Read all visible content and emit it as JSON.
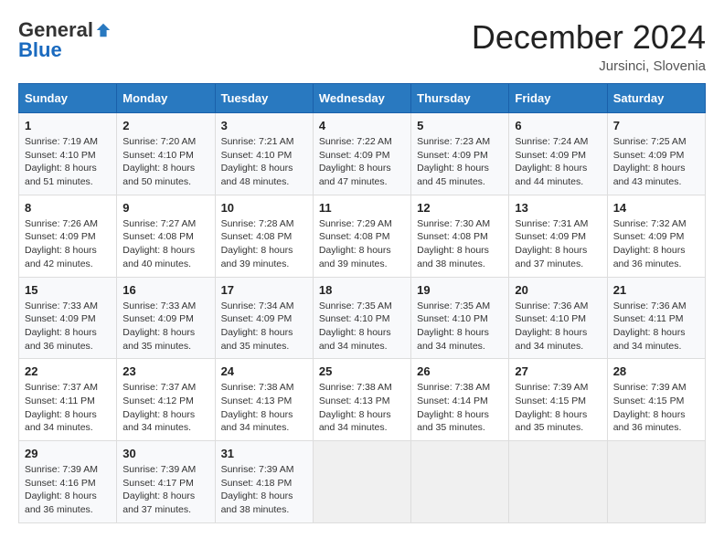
{
  "logo": {
    "general": "General",
    "blue": "Blue"
  },
  "header": {
    "month": "December 2024",
    "location": "Jursinci, Slovenia"
  },
  "weekdays": [
    "Sunday",
    "Monday",
    "Tuesday",
    "Wednesday",
    "Thursday",
    "Friday",
    "Saturday"
  ],
  "weeks": [
    [
      {
        "day": 1,
        "sunrise": "7:19 AM",
        "sunset": "4:10 PM",
        "daylight": "8 hours and 51 minutes."
      },
      {
        "day": 2,
        "sunrise": "7:20 AM",
        "sunset": "4:10 PM",
        "daylight": "8 hours and 50 minutes."
      },
      {
        "day": 3,
        "sunrise": "7:21 AM",
        "sunset": "4:10 PM",
        "daylight": "8 hours and 48 minutes."
      },
      {
        "day": 4,
        "sunrise": "7:22 AM",
        "sunset": "4:09 PM",
        "daylight": "8 hours and 47 minutes."
      },
      {
        "day": 5,
        "sunrise": "7:23 AM",
        "sunset": "4:09 PM",
        "daylight": "8 hours and 45 minutes."
      },
      {
        "day": 6,
        "sunrise": "7:24 AM",
        "sunset": "4:09 PM",
        "daylight": "8 hours and 44 minutes."
      },
      {
        "day": 7,
        "sunrise": "7:25 AM",
        "sunset": "4:09 PM",
        "daylight": "8 hours and 43 minutes."
      }
    ],
    [
      {
        "day": 8,
        "sunrise": "7:26 AM",
        "sunset": "4:09 PM",
        "daylight": "8 hours and 42 minutes."
      },
      {
        "day": 9,
        "sunrise": "7:27 AM",
        "sunset": "4:08 PM",
        "daylight": "8 hours and 40 minutes."
      },
      {
        "day": 10,
        "sunrise": "7:28 AM",
        "sunset": "4:08 PM",
        "daylight": "8 hours and 39 minutes."
      },
      {
        "day": 11,
        "sunrise": "7:29 AM",
        "sunset": "4:08 PM",
        "daylight": "8 hours and 39 minutes."
      },
      {
        "day": 12,
        "sunrise": "7:30 AM",
        "sunset": "4:08 PM",
        "daylight": "8 hours and 38 minutes."
      },
      {
        "day": 13,
        "sunrise": "7:31 AM",
        "sunset": "4:09 PM",
        "daylight": "8 hours and 37 minutes."
      },
      {
        "day": 14,
        "sunrise": "7:32 AM",
        "sunset": "4:09 PM",
        "daylight": "8 hours and 36 minutes."
      }
    ],
    [
      {
        "day": 15,
        "sunrise": "7:33 AM",
        "sunset": "4:09 PM",
        "daylight": "8 hours and 36 minutes."
      },
      {
        "day": 16,
        "sunrise": "7:33 AM",
        "sunset": "4:09 PM",
        "daylight": "8 hours and 35 minutes."
      },
      {
        "day": 17,
        "sunrise": "7:34 AM",
        "sunset": "4:09 PM",
        "daylight": "8 hours and 35 minutes."
      },
      {
        "day": 18,
        "sunrise": "7:35 AM",
        "sunset": "4:10 PM",
        "daylight": "8 hours and 34 minutes."
      },
      {
        "day": 19,
        "sunrise": "7:35 AM",
        "sunset": "4:10 PM",
        "daylight": "8 hours and 34 minutes."
      },
      {
        "day": 20,
        "sunrise": "7:36 AM",
        "sunset": "4:10 PM",
        "daylight": "8 hours and 34 minutes."
      },
      {
        "day": 21,
        "sunrise": "7:36 AM",
        "sunset": "4:11 PM",
        "daylight": "8 hours and 34 minutes."
      }
    ],
    [
      {
        "day": 22,
        "sunrise": "7:37 AM",
        "sunset": "4:11 PM",
        "daylight": "8 hours and 34 minutes."
      },
      {
        "day": 23,
        "sunrise": "7:37 AM",
        "sunset": "4:12 PM",
        "daylight": "8 hours and 34 minutes."
      },
      {
        "day": 24,
        "sunrise": "7:38 AM",
        "sunset": "4:13 PM",
        "daylight": "8 hours and 34 minutes."
      },
      {
        "day": 25,
        "sunrise": "7:38 AM",
        "sunset": "4:13 PM",
        "daylight": "8 hours and 34 minutes."
      },
      {
        "day": 26,
        "sunrise": "7:38 AM",
        "sunset": "4:14 PM",
        "daylight": "8 hours and 35 minutes."
      },
      {
        "day": 27,
        "sunrise": "7:39 AM",
        "sunset": "4:15 PM",
        "daylight": "8 hours and 35 minutes."
      },
      {
        "day": 28,
        "sunrise": "7:39 AM",
        "sunset": "4:15 PM",
        "daylight": "8 hours and 36 minutes."
      }
    ],
    [
      {
        "day": 29,
        "sunrise": "7:39 AM",
        "sunset": "4:16 PM",
        "daylight": "8 hours and 36 minutes."
      },
      {
        "day": 30,
        "sunrise": "7:39 AM",
        "sunset": "4:17 PM",
        "daylight": "8 hours and 37 minutes."
      },
      {
        "day": 31,
        "sunrise": "7:39 AM",
        "sunset": "4:18 PM",
        "daylight": "8 hours and 38 minutes."
      },
      null,
      null,
      null,
      null
    ]
  ]
}
